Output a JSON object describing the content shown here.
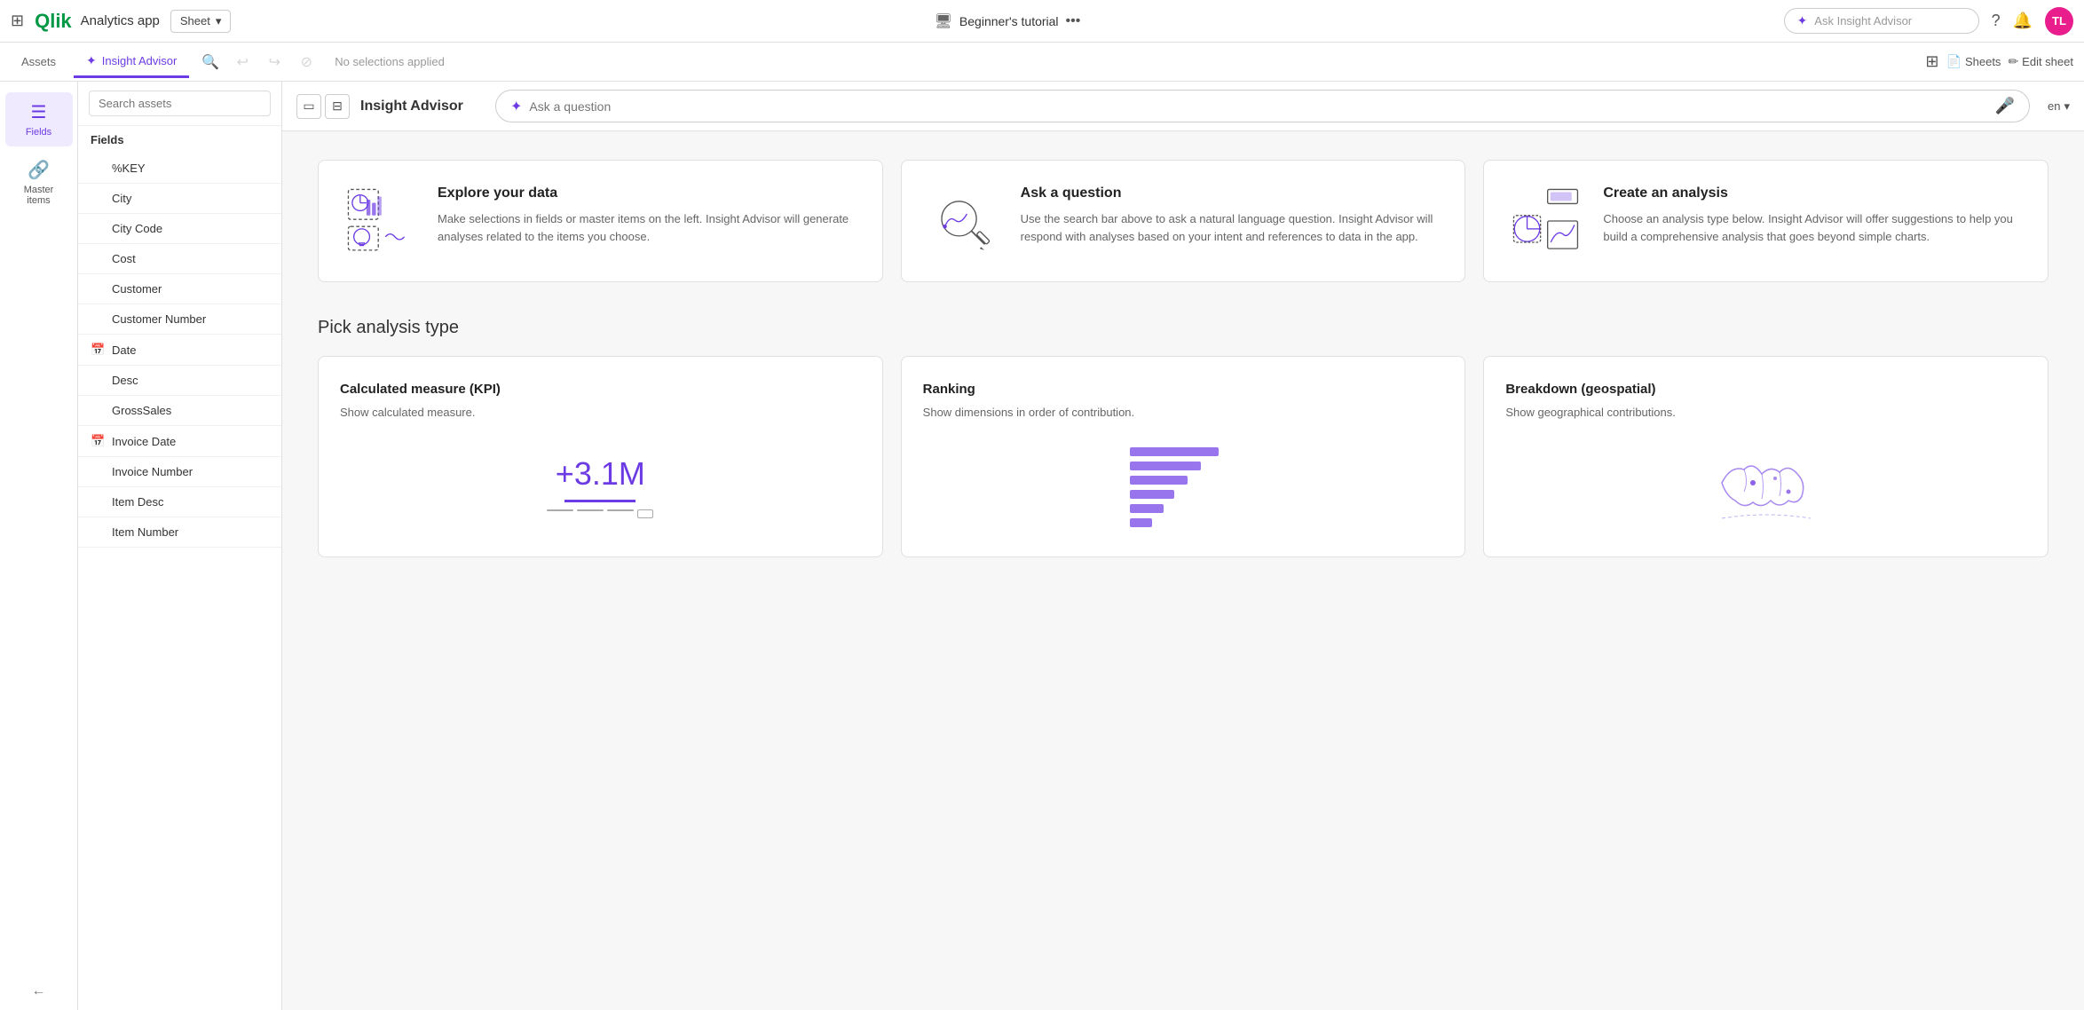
{
  "topNav": {
    "appTitle": "Analytics app",
    "sheetLabel": "Sheet",
    "tutorialLabel": "Beginner's tutorial",
    "askAdvisorPlaceholder": "Ask Insight Advisor",
    "avatarInitials": "TL"
  },
  "secondaryNav": {
    "assetsLabel": "Assets",
    "insightLabel": "Insight Advisor",
    "selectionInfo": "No selections applied",
    "sheetsLabel": "Sheets",
    "editSheetLabel": "Edit sheet"
  },
  "leftPanel": {
    "fieldsLabel": "Fields",
    "masterItemsLabel": "Master items"
  },
  "fieldsPanel": {
    "searchPlaceholder": "Search assets",
    "sectionLabel": "Fields",
    "fields": [
      {
        "name": "%KEY",
        "icon": ""
      },
      {
        "name": "City",
        "icon": ""
      },
      {
        "name": "City Code",
        "icon": ""
      },
      {
        "name": "Cost",
        "icon": ""
      },
      {
        "name": "Customer",
        "icon": ""
      },
      {
        "name": "Customer Number",
        "icon": ""
      },
      {
        "name": "Date",
        "icon": "calendar"
      },
      {
        "name": "Desc",
        "icon": ""
      },
      {
        "name": "GrossSales",
        "icon": ""
      },
      {
        "name": "Invoice Date",
        "icon": "calendar"
      },
      {
        "name": "Invoice Number",
        "icon": ""
      },
      {
        "name": "Item Desc",
        "icon": ""
      },
      {
        "name": "Item Number",
        "icon": ""
      }
    ]
  },
  "insightAdvisor": {
    "title": "Insight Advisor",
    "searchPlaceholder": "Ask a question",
    "langLabel": "en"
  },
  "cards": [
    {
      "id": "explore",
      "title": "Explore your data",
      "description": "Make selections in fields or master items on the left. Insight Advisor will generate analyses related to the items you choose."
    },
    {
      "id": "ask",
      "title": "Ask a question",
      "description": "Use the search bar above to ask a natural language question. Insight Advisor will respond with analyses based on your intent and references to data in the app."
    },
    {
      "id": "create",
      "title": "Create an analysis",
      "description": "Choose an analysis type below. Insight Advisor will offer suggestions to help you build a comprehensive analysis that goes beyond simple charts."
    }
  ],
  "analysisSection": {
    "title": "Pick analysis type",
    "types": [
      {
        "id": "kpi",
        "title": "Calculated measure (KPI)",
        "description": "Show calculated measure.",
        "kpiValue": "+3.1M"
      },
      {
        "id": "ranking",
        "title": "Ranking",
        "description": "Show dimensions in order of contribution."
      },
      {
        "id": "geo",
        "title": "Breakdown (geospatial)",
        "description": "Show geographical contributions."
      }
    ]
  }
}
